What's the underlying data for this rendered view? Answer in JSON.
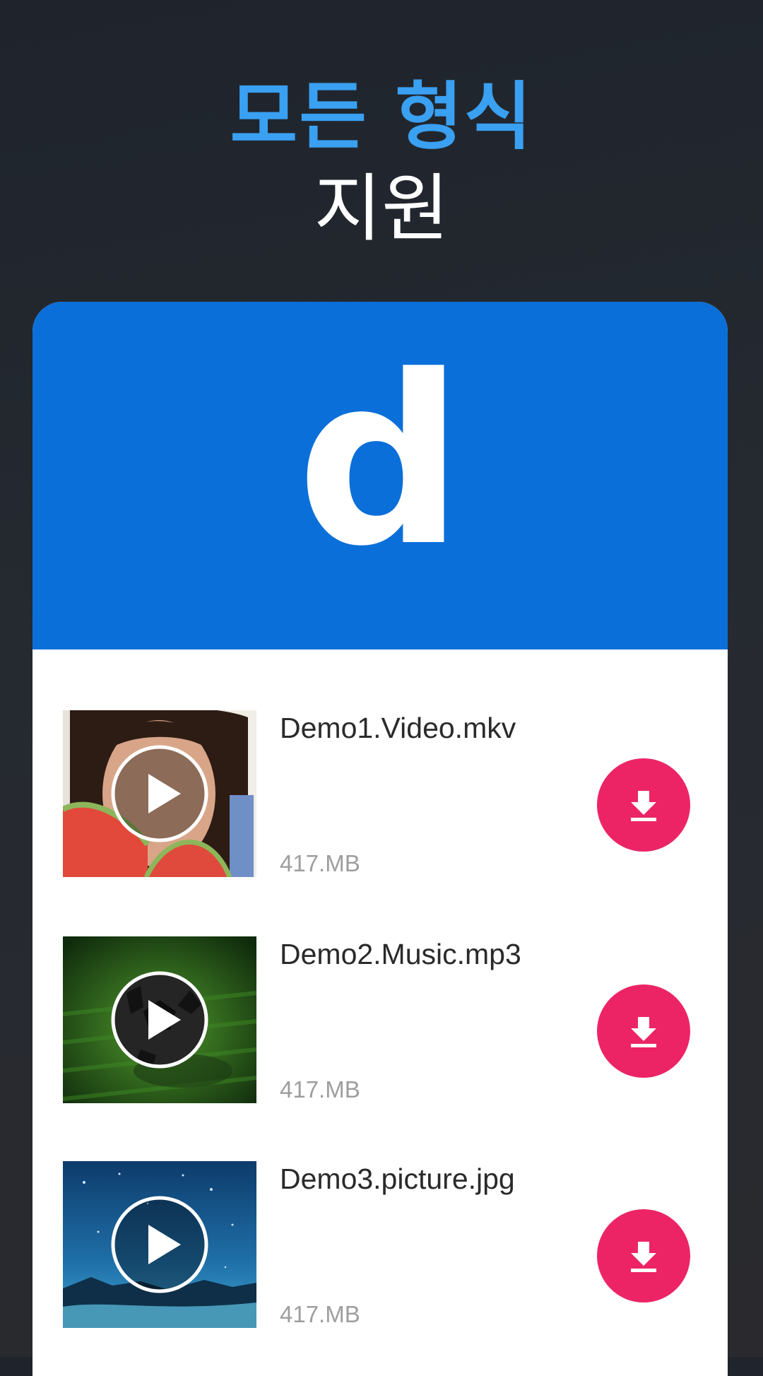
{
  "headline": {
    "line1": "모든 형식",
    "line2": "지원"
  },
  "brand": {
    "logo_letter": "d",
    "banner_color": "#0b6fd9"
  },
  "files": [
    {
      "name": "Demo1.Video.mkv",
      "size": "417.MB",
      "thumbnail": "face-photo",
      "action_icon": "download-icon"
    },
    {
      "name": "Demo2.Music.mp3",
      "size": "417.MB",
      "thumbnail": "soccer-ball-photo",
      "action_icon": "download-icon"
    },
    {
      "name": "Demo3.picture.jpg",
      "size": "417.MB",
      "thumbnail": "night-sky-photo",
      "action_icon": "download-icon"
    }
  ],
  "colors": {
    "accent_blue": "#3aa0f2",
    "download_pink": "#ec2465",
    "text_dark": "#2a2a2a",
    "text_muted": "#9e9e9e"
  }
}
